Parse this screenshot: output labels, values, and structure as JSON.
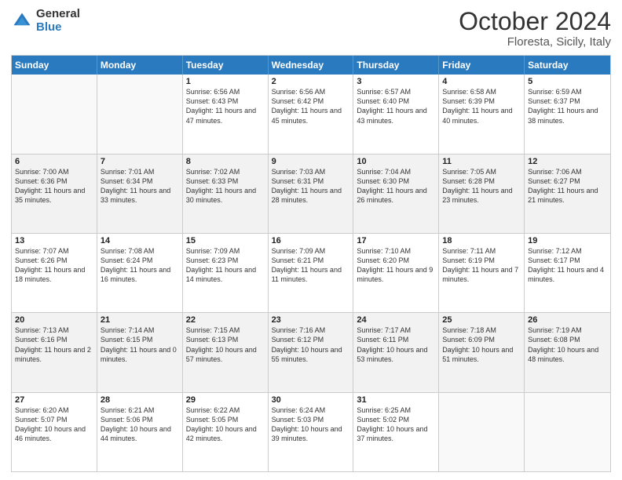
{
  "logo": {
    "general": "General",
    "blue": "Blue"
  },
  "title": {
    "month": "October 2024",
    "location": "Floresta, Sicily, Italy"
  },
  "header": {
    "days": [
      "Sunday",
      "Monday",
      "Tuesday",
      "Wednesday",
      "Thursday",
      "Friday",
      "Saturday"
    ]
  },
  "rows": [
    {
      "alt": false,
      "cells": [
        {
          "day": "",
          "text": ""
        },
        {
          "day": "",
          "text": ""
        },
        {
          "day": "1",
          "text": "Sunrise: 6:56 AM\nSunset: 6:43 PM\nDaylight: 11 hours and 47 minutes."
        },
        {
          "day": "2",
          "text": "Sunrise: 6:56 AM\nSunset: 6:42 PM\nDaylight: 11 hours and 45 minutes."
        },
        {
          "day": "3",
          "text": "Sunrise: 6:57 AM\nSunset: 6:40 PM\nDaylight: 11 hours and 43 minutes."
        },
        {
          "day": "4",
          "text": "Sunrise: 6:58 AM\nSunset: 6:39 PM\nDaylight: 11 hours and 40 minutes."
        },
        {
          "day": "5",
          "text": "Sunrise: 6:59 AM\nSunset: 6:37 PM\nDaylight: 11 hours and 38 minutes."
        }
      ]
    },
    {
      "alt": true,
      "cells": [
        {
          "day": "6",
          "text": "Sunrise: 7:00 AM\nSunset: 6:36 PM\nDaylight: 11 hours and 35 minutes."
        },
        {
          "day": "7",
          "text": "Sunrise: 7:01 AM\nSunset: 6:34 PM\nDaylight: 11 hours and 33 minutes."
        },
        {
          "day": "8",
          "text": "Sunrise: 7:02 AM\nSunset: 6:33 PM\nDaylight: 11 hours and 30 minutes."
        },
        {
          "day": "9",
          "text": "Sunrise: 7:03 AM\nSunset: 6:31 PM\nDaylight: 11 hours and 28 minutes."
        },
        {
          "day": "10",
          "text": "Sunrise: 7:04 AM\nSunset: 6:30 PM\nDaylight: 11 hours and 26 minutes."
        },
        {
          "day": "11",
          "text": "Sunrise: 7:05 AM\nSunset: 6:28 PM\nDaylight: 11 hours and 23 minutes."
        },
        {
          "day": "12",
          "text": "Sunrise: 7:06 AM\nSunset: 6:27 PM\nDaylight: 11 hours and 21 minutes."
        }
      ]
    },
    {
      "alt": false,
      "cells": [
        {
          "day": "13",
          "text": "Sunrise: 7:07 AM\nSunset: 6:26 PM\nDaylight: 11 hours and 18 minutes."
        },
        {
          "day": "14",
          "text": "Sunrise: 7:08 AM\nSunset: 6:24 PM\nDaylight: 11 hours and 16 minutes."
        },
        {
          "day": "15",
          "text": "Sunrise: 7:09 AM\nSunset: 6:23 PM\nDaylight: 11 hours and 14 minutes."
        },
        {
          "day": "16",
          "text": "Sunrise: 7:09 AM\nSunset: 6:21 PM\nDaylight: 11 hours and 11 minutes."
        },
        {
          "day": "17",
          "text": "Sunrise: 7:10 AM\nSunset: 6:20 PM\nDaylight: 11 hours and 9 minutes."
        },
        {
          "day": "18",
          "text": "Sunrise: 7:11 AM\nSunset: 6:19 PM\nDaylight: 11 hours and 7 minutes."
        },
        {
          "day": "19",
          "text": "Sunrise: 7:12 AM\nSunset: 6:17 PM\nDaylight: 11 hours and 4 minutes."
        }
      ]
    },
    {
      "alt": true,
      "cells": [
        {
          "day": "20",
          "text": "Sunrise: 7:13 AM\nSunset: 6:16 PM\nDaylight: 11 hours and 2 minutes."
        },
        {
          "day": "21",
          "text": "Sunrise: 7:14 AM\nSunset: 6:15 PM\nDaylight: 11 hours and 0 minutes."
        },
        {
          "day": "22",
          "text": "Sunrise: 7:15 AM\nSunset: 6:13 PM\nDaylight: 10 hours and 57 minutes."
        },
        {
          "day": "23",
          "text": "Sunrise: 7:16 AM\nSunset: 6:12 PM\nDaylight: 10 hours and 55 minutes."
        },
        {
          "day": "24",
          "text": "Sunrise: 7:17 AM\nSunset: 6:11 PM\nDaylight: 10 hours and 53 minutes."
        },
        {
          "day": "25",
          "text": "Sunrise: 7:18 AM\nSunset: 6:09 PM\nDaylight: 10 hours and 51 minutes."
        },
        {
          "day": "26",
          "text": "Sunrise: 7:19 AM\nSunset: 6:08 PM\nDaylight: 10 hours and 48 minutes."
        }
      ]
    },
    {
      "alt": false,
      "cells": [
        {
          "day": "27",
          "text": "Sunrise: 6:20 AM\nSunset: 5:07 PM\nDaylight: 10 hours and 46 minutes."
        },
        {
          "day": "28",
          "text": "Sunrise: 6:21 AM\nSunset: 5:06 PM\nDaylight: 10 hours and 44 minutes."
        },
        {
          "day": "29",
          "text": "Sunrise: 6:22 AM\nSunset: 5:05 PM\nDaylight: 10 hours and 42 minutes."
        },
        {
          "day": "30",
          "text": "Sunrise: 6:24 AM\nSunset: 5:03 PM\nDaylight: 10 hours and 39 minutes."
        },
        {
          "day": "31",
          "text": "Sunrise: 6:25 AM\nSunset: 5:02 PM\nDaylight: 10 hours and 37 minutes."
        },
        {
          "day": "",
          "text": ""
        },
        {
          "day": "",
          "text": ""
        }
      ]
    }
  ]
}
